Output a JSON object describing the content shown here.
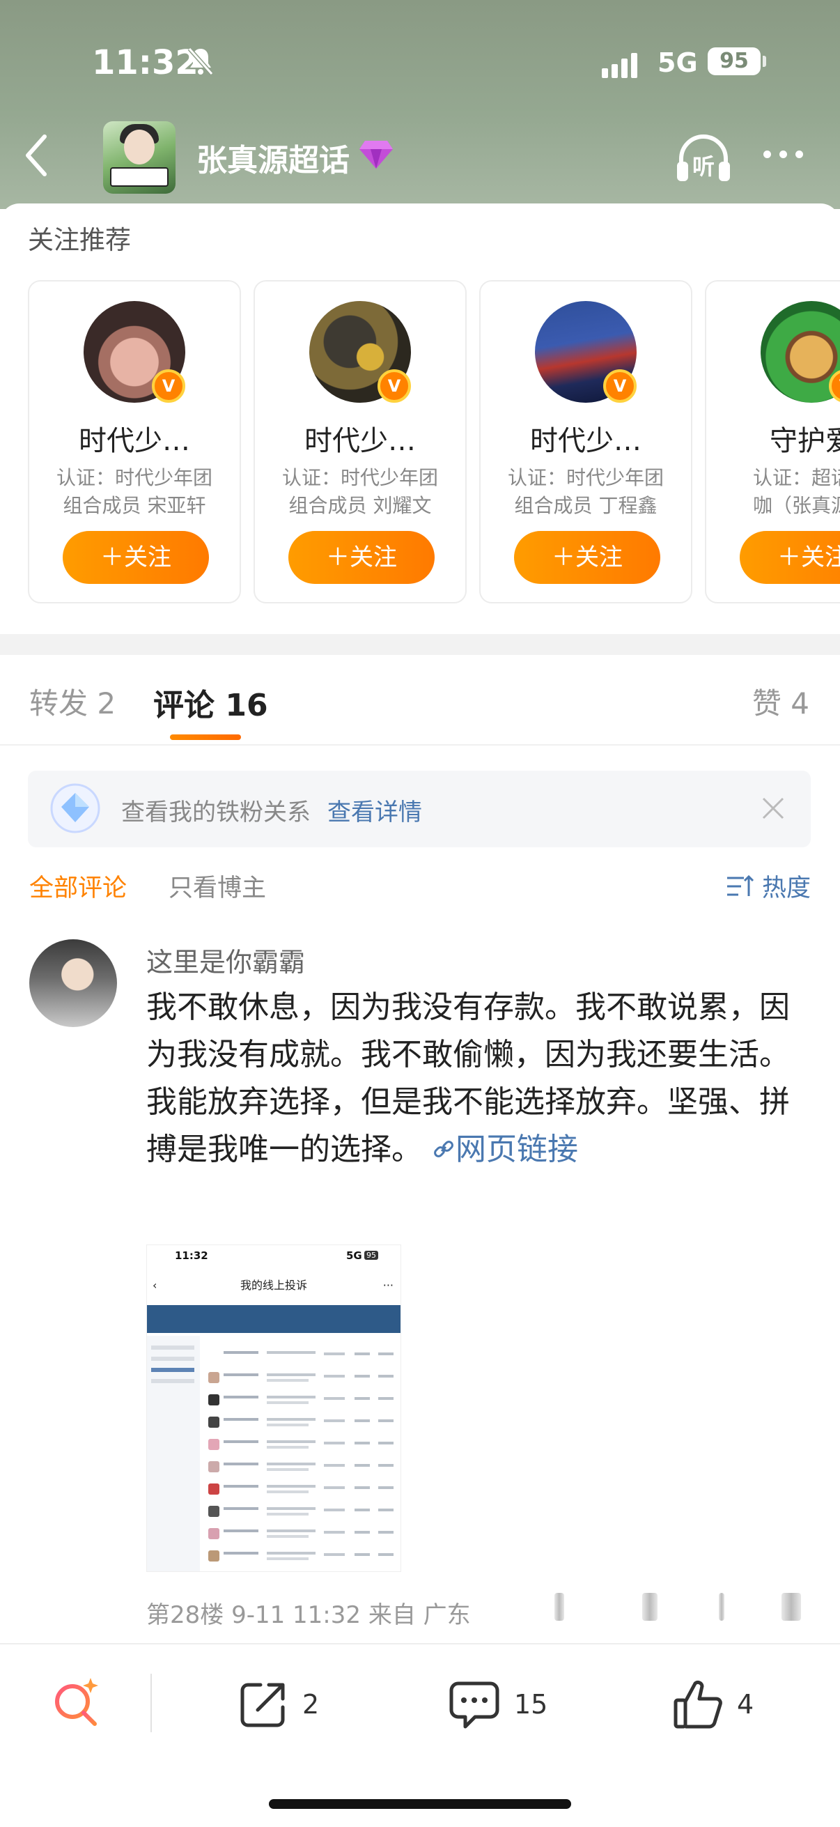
{
  "status_bar": {
    "time": "11:32",
    "network": "5G",
    "battery": "95"
  },
  "header": {
    "title": "张真源超话"
  },
  "recommend": {
    "title": "关注推荐",
    "follow_label": "＋关注",
    "cards": [
      {
        "name": "时代少…",
        "verify_line1": "认证：时代少年团",
        "verify_line2": "组合成员 宋亚轩"
      },
      {
        "name": "时代少…",
        "verify_line1": "认证：时代少年团",
        "verify_line2": "组合成员 刘耀文"
      },
      {
        "name": "时代少…",
        "verify_line1": "认证：时代少年团",
        "verify_line2": "组合成员 丁程鑫"
      },
      {
        "name": "守护爱",
        "verify_line1": "认证：超话粉",
        "verify_line2": "咖（张真源超"
      }
    ]
  },
  "tabs": {
    "repost_label": "转发",
    "repost_count": "2",
    "comment_label": "评论",
    "comment_count": "16",
    "like_label": "赞",
    "like_count": "4"
  },
  "fan_banner": {
    "text": "查看我的铁粉关系",
    "link": "查看详情"
  },
  "filters": {
    "all": "全部评论",
    "op_only": "只看博主",
    "sort": "热度"
  },
  "comment": {
    "username": "这里是你霸霸",
    "text": "我不敢休息，因为我没有存款。我不敢说累，因为我没有成就。我不敢偷懒，因为我还要生活。我能放弃选择，但是我不能选择放弃。坚强、拼搏是我唯一的选择。",
    "link_text": "网页链接",
    "image": {
      "time": "11:32",
      "network": "5G",
      "battery": "95",
      "title": "我的线上投诉"
    },
    "meta": "第28楼 9-11 11:32 来自 广东"
  },
  "toolbar": {
    "repost_count": "2",
    "comment_count": "15",
    "like_count": "4"
  }
}
